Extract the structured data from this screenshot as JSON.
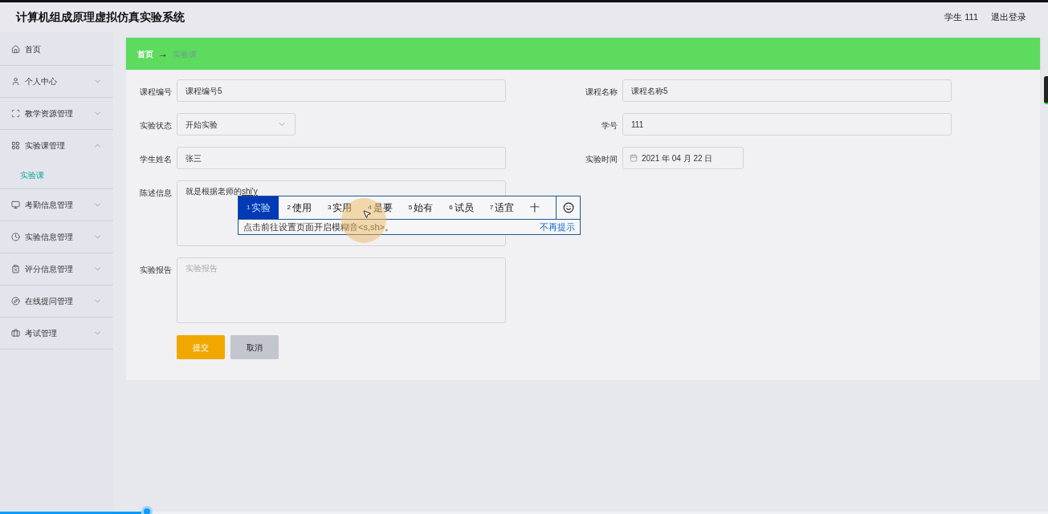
{
  "header": {
    "title": "计算机组成原理虚拟仿真实验系统",
    "user": "学生 111",
    "logout": "退出登录"
  },
  "sidebar": {
    "items": [
      {
        "label": "首页"
      },
      {
        "label": "个人中心",
        "expanded": false
      },
      {
        "label": "教学资源管理",
        "expanded": false
      },
      {
        "label": "实验课管理",
        "expanded": true,
        "children": [
          {
            "label": "实验课",
            "selected": true
          }
        ]
      },
      {
        "label": "考勤信息管理",
        "expanded": false
      },
      {
        "label": "实验信息管理",
        "expanded": false
      },
      {
        "label": "评分信息管理",
        "expanded": false
      },
      {
        "label": "在线提问管理",
        "expanded": false
      },
      {
        "label": "考试管理",
        "expanded": false
      }
    ]
  },
  "breadcrumb": {
    "items": [
      "首页",
      "实验课"
    ],
    "separator": "→"
  },
  "form": {
    "rows": [
      [
        {
          "label": "课程编号",
          "kind": "text",
          "value": "课程编号5"
        },
        {
          "label": "课程名称",
          "kind": "text",
          "value": "课程名称5"
        }
      ],
      [
        {
          "label": "实验状态",
          "kind": "select",
          "value": "开始实验"
        },
        {
          "label": "学号",
          "kind": "text",
          "value": "111"
        }
      ],
      [
        {
          "label": "学生姓名",
          "kind": "text",
          "value": "张三"
        },
        {
          "label": "实验时间",
          "kind": "date",
          "value": "2021 年 04 月 22 日"
        }
      ],
      [
        {
          "label": "陈述信息",
          "kind": "textarea",
          "value": "就是根据老师的",
          "composition": "shi'y"
        }
      ],
      [
        {
          "label": "实验报告",
          "kind": "textarea",
          "placeholder": "实验报告"
        }
      ]
    ],
    "buttons": [
      {
        "label": "提交",
        "kind": "primary"
      },
      {
        "label": "取消",
        "kind": "secondary"
      }
    ]
  },
  "ime": {
    "candidates": [
      {
        "index": "1",
        "text": "实验",
        "selected": true
      },
      {
        "index": "2",
        "text": "使用",
        "selected": false
      },
      {
        "index": "3",
        "text": "实用",
        "selected": false
      },
      {
        "index": "4",
        "text": "是要",
        "selected": false
      },
      {
        "index": "5",
        "text": "始有",
        "selected": false
      },
      {
        "index": "6",
        "text": "试员",
        "selected": false
      },
      {
        "index": "7",
        "text": "适宜",
        "selected": false
      },
      {
        "text": "十",
        "selected": false
      }
    ],
    "hint": "点击前往设置页面开启模糊音<s,sh>。",
    "dismiss": "不再提示"
  },
  "video": {
    "progress": {
      "level": 0.14
    }
  }
}
